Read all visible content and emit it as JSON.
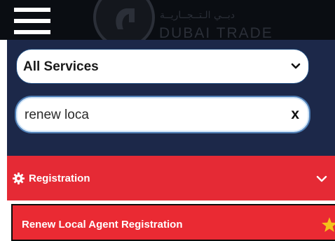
{
  "header": {
    "menu_icon": "hamburger-menu-icon",
    "logo_icon": "dubai-trade-emblem-icon",
    "logo_text_ar": "دبــي الـتــجــاريــة",
    "logo_text_en": "DUBAI TRADE"
  },
  "filter": {
    "selected_service": "All Services",
    "chevron_icon": "chevron-down-icon"
  },
  "search": {
    "value": "renew loca",
    "clear_label": "x"
  },
  "results": {
    "category": {
      "label": "Registration",
      "icon": "gear-icon",
      "chevron_icon": "chevron-down-icon"
    },
    "items": [
      {
        "label": "Renew Local Agent Registration",
        "icon": "star-icon"
      }
    ]
  },
  "colors": {
    "header_bg": "#0a0d12",
    "panel_bg": "#1c2849",
    "category_bg": "#e52a35",
    "result_bg": "#ea2a33",
    "star": "#f4c21a"
  }
}
